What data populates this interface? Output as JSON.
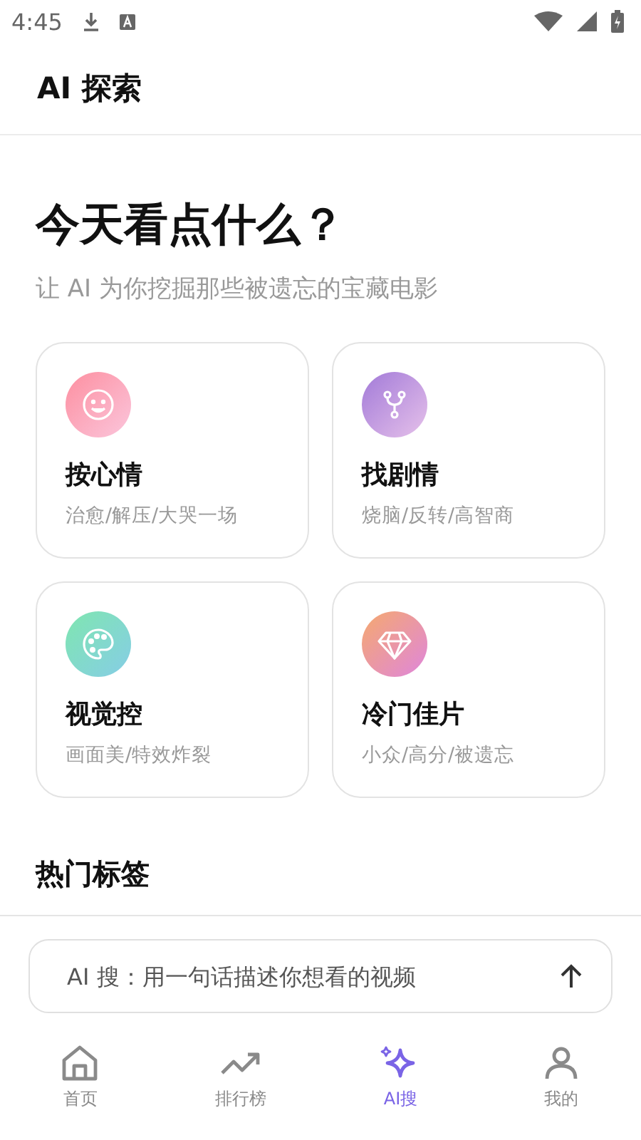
{
  "status_bar": {
    "time": "4:45"
  },
  "header": {
    "title": "AI 探索"
  },
  "hero": {
    "title": "今天看点什么？",
    "subtitle": "让 AI 为你挖掘那些被遗忘的宝藏电影"
  },
  "categories": [
    {
      "kind": "mood",
      "title": "按心情",
      "tags": "治愈/解压/大哭一场"
    },
    {
      "kind": "plot",
      "title": "找剧情",
      "tags": "烧脑/反转/高智商"
    },
    {
      "kind": "visual",
      "title": "视觉控",
      "tags": "画面美/特效炸裂"
    },
    {
      "kind": "gem",
      "title": "冷门佳片",
      "tags": "小众/高分/被遗忘"
    }
  ],
  "section_title": "热门标签",
  "search": {
    "placeholder": "AI 搜：用一句话描述你想看的视频"
  },
  "nav": [
    {
      "kind": "home",
      "label": "首页",
      "selected": false
    },
    {
      "kind": "trend",
      "label": "排行榜",
      "selected": false
    },
    {
      "kind": "ai",
      "label": "AI搜",
      "selected": true
    },
    {
      "kind": "me",
      "label": "我的",
      "selected": false
    }
  ]
}
